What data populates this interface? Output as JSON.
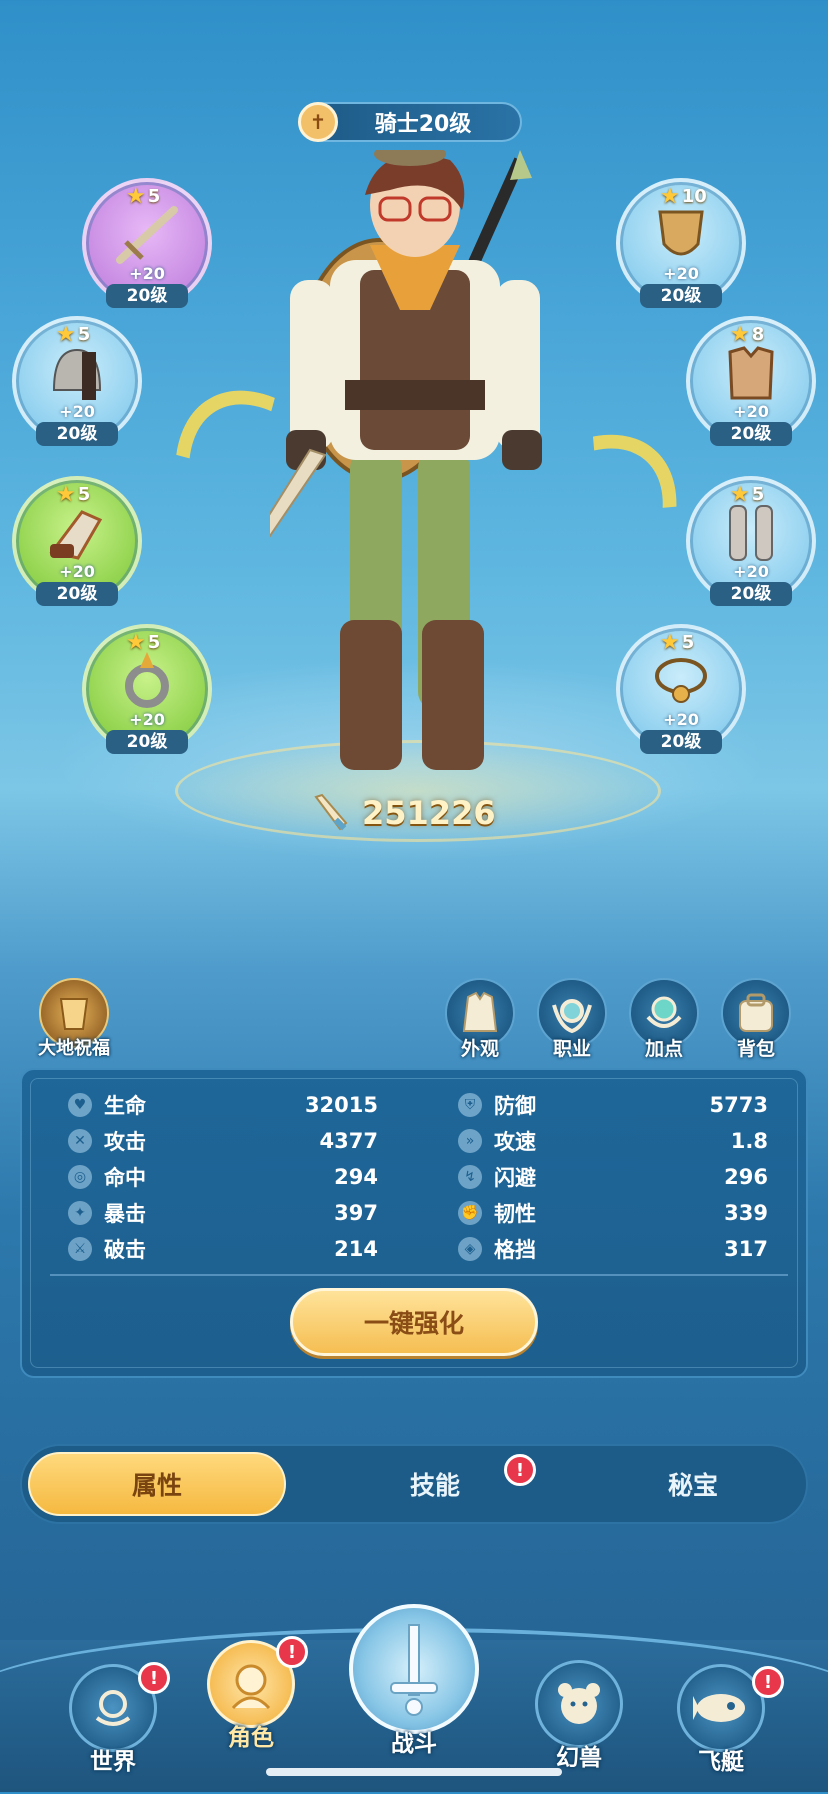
{
  "header": {
    "level_title": "骑士20级"
  },
  "equipment_left": [
    {
      "stars": "5",
      "plus": "+20",
      "level": "20级",
      "icon": "sword-icon",
      "rarity": "purple"
    },
    {
      "stars": "5",
      "plus": "+20",
      "level": "20级",
      "icon": "helmet-icon",
      "rarity": "blue"
    },
    {
      "stars": "5",
      "plus": "+20",
      "level": "20级",
      "icon": "gauntlet-icon",
      "rarity": "green"
    },
    {
      "stars": "5",
      "plus": "+20",
      "level": "20级",
      "icon": "ring-icon",
      "rarity": "green"
    }
  ],
  "equipment_right": [
    {
      "stars": "10",
      "plus": "+20",
      "level": "20级",
      "icon": "shield-icon",
      "rarity": "blue"
    },
    {
      "stars": "8",
      "plus": "+20",
      "level": "20级",
      "icon": "armor-icon",
      "rarity": "blue"
    },
    {
      "stars": "5",
      "plus": "+20",
      "level": "20级",
      "icon": "boots-icon",
      "rarity": "blue"
    },
    {
      "stars": "5",
      "plus": "+20",
      "level": "20级",
      "icon": "necklace-icon",
      "rarity": "blue"
    }
  ],
  "power": "251226",
  "features": {
    "blessing": "大地祝福",
    "appearance": "外观",
    "job": "职业",
    "points": "加点",
    "bag": "背包"
  },
  "stats_left": [
    {
      "name": "生命",
      "value": "32015",
      "icon": "heart-icon"
    },
    {
      "name": "攻击",
      "value": "4377",
      "icon": "swords-icon"
    },
    {
      "name": "命中",
      "value": "294",
      "icon": "target-icon"
    },
    {
      "name": "暴击",
      "value": "397",
      "icon": "crit-icon"
    },
    {
      "name": "破击",
      "value": "214",
      "icon": "break-icon"
    }
  ],
  "stats_right": [
    {
      "name": "防御",
      "value": "5773",
      "icon": "defense-icon"
    },
    {
      "name": "攻速",
      "value": "1.8",
      "icon": "attack-speed-icon"
    },
    {
      "name": "闪避",
      "value": "296",
      "icon": "dodge-icon"
    },
    {
      "name": "韧性",
      "value": "339",
      "icon": "toughness-icon"
    },
    {
      "name": "格挡",
      "value": "317",
      "icon": "block-icon"
    }
  ],
  "enhance_button": "一键强化",
  "tabs": [
    "属性",
    "技能",
    "秘宝"
  ],
  "nav": {
    "world": "世界",
    "character": "角色",
    "battle": "战斗",
    "pet": "幻兽",
    "airship": "飞艇"
  },
  "badge_text": "!",
  "colors": {
    "accent_gold": "#f5be52",
    "panel_blue": "#1f6799",
    "badge_red": "#e8364a"
  }
}
